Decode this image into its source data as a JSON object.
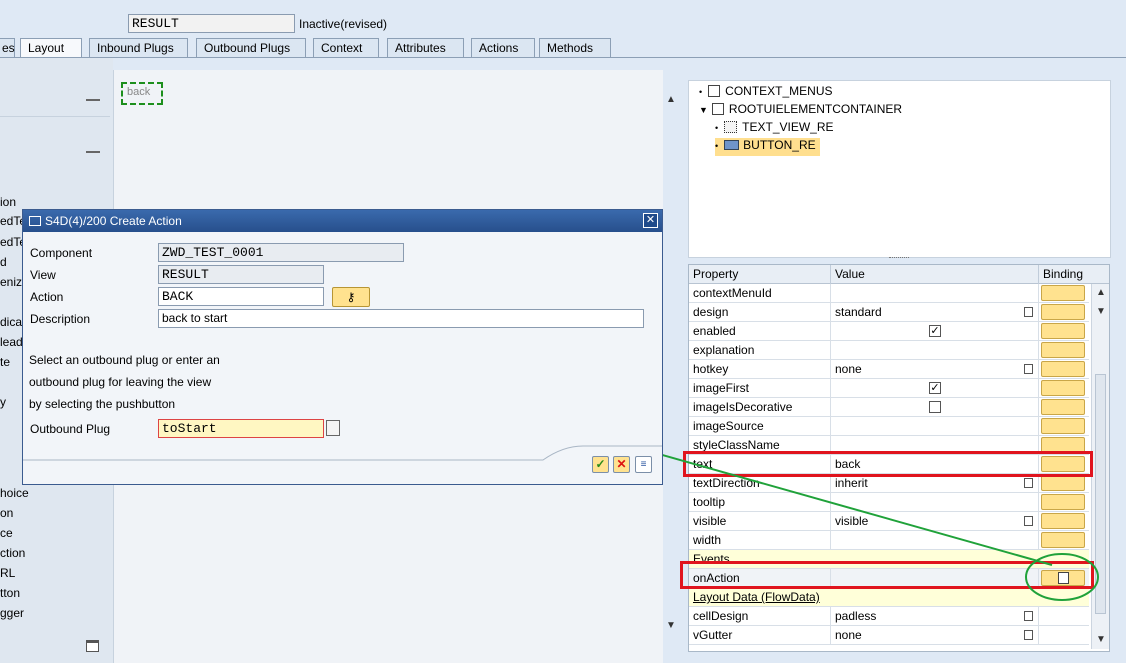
{
  "header": {
    "view_field": "RESULT",
    "status": "Inactive(revised)"
  },
  "tabs": [
    {
      "label": "es",
      "active": false
    },
    {
      "label": "Layout",
      "active": true
    },
    {
      "label": "Inbound Plugs",
      "active": false
    },
    {
      "label": "Outbound Plugs",
      "active": false
    },
    {
      "label": "Context",
      "active": false
    },
    {
      "label": "Attributes",
      "active": false
    },
    {
      "label": "Actions",
      "active": false
    },
    {
      "label": "Methods",
      "active": false
    }
  ],
  "left_panel": {
    "items": [
      "ion",
      "edTe",
      "edTe",
      "d",
      "eniz",
      "dicat",
      "lead",
      "te",
      "y",
      "hoice",
      "on",
      "ce",
      "ction",
      "RL",
      "tton",
      "gger"
    ]
  },
  "canvas": {
    "button_text": "back"
  },
  "tree": {
    "items": [
      {
        "label": "CONTEXT_MENUS",
        "icon": "checkbox-icon",
        "level": 0
      },
      {
        "label": "ROOTUIELEMENTCONTAINER",
        "icon": "checkbox-icon",
        "level": 0
      },
      {
        "label": "TEXT_VIEW_RE",
        "icon": "textview-icon",
        "level": 1
      },
      {
        "label": "BUTTON_RE",
        "icon": "button-icon",
        "level": 1
      }
    ]
  },
  "properties": {
    "headers": {
      "property": "Property",
      "value": "Value",
      "binding": "Binding"
    },
    "rows": [
      {
        "property": "contextMenuId",
        "value": "",
        "kind": "plain",
        "bind": true
      },
      {
        "property": "design",
        "value": "standard",
        "kind": "select",
        "bind": true
      },
      {
        "property": "enabled",
        "value": "",
        "kind": "checked",
        "bind": true
      },
      {
        "property": "explanation",
        "value": "",
        "kind": "plain",
        "bind": true
      },
      {
        "property": "hotkey",
        "value": "none",
        "kind": "select",
        "bind": true
      },
      {
        "property": "imageFirst",
        "value": "",
        "kind": "checked",
        "bind": true
      },
      {
        "property": "imageIsDecorative",
        "value": "",
        "kind": "unchecked",
        "bind": true
      },
      {
        "property": "imageSource",
        "value": "",
        "kind": "plain",
        "bind": true
      },
      {
        "property": "styleClassName",
        "value": "",
        "kind": "plain",
        "bind": true
      },
      {
        "property": "text",
        "value": "back",
        "kind": "plain",
        "bind": true
      },
      {
        "property": "textDirection",
        "value": "inherit",
        "kind": "select",
        "bind": true
      },
      {
        "property": "tooltip",
        "value": "",
        "kind": "plain",
        "bind": true
      },
      {
        "property": "visible",
        "value": "visible",
        "kind": "select",
        "bind": true
      },
      {
        "property": "width",
        "value": "",
        "kind": "plain",
        "bind": true
      },
      {
        "property": "Events",
        "value": "",
        "kind": "section",
        "bind": false
      },
      {
        "property": "onAction",
        "value": "",
        "kind": "event",
        "bind": false
      },
      {
        "property": "Layout Data (FlowData)",
        "value": "",
        "kind": "section-link",
        "bind": false
      },
      {
        "property": "cellDesign",
        "value": "padless",
        "kind": "select",
        "bind": false
      },
      {
        "property": "vGutter",
        "value": "none",
        "kind": "select",
        "bind": false
      }
    ]
  },
  "dialog": {
    "title": "S4D(4)/200 Create Action",
    "component_label": "Component",
    "component_value": "ZWD_TEST_0001",
    "view_label": "View",
    "view_value": "RESULT",
    "action_label": "Action",
    "action_value": "BACK",
    "description_label": "Description",
    "description_value": "back to start",
    "help_line1": "Select an outbound plug or enter an",
    "help_line2": "outbound plug for leaving the view",
    "help_line3": "by selecting the pushbutton",
    "plug_label": "Outbound Plug",
    "plug_value": "toStart"
  },
  "colors": {
    "highlight_red": "#e0141e",
    "annotation_green": "#20a23a",
    "binding_button": "#ffe28f"
  }
}
